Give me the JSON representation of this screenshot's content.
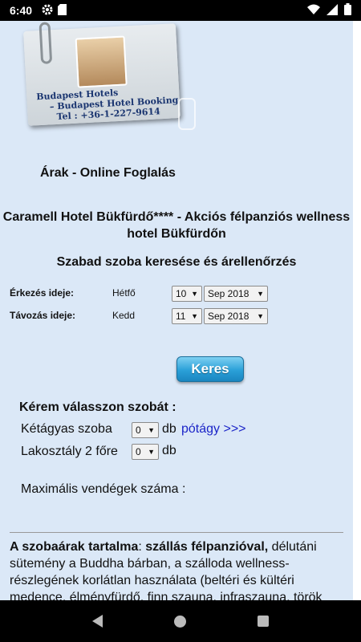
{
  "statusbar": {
    "time": "6:40",
    "icons": [
      "gear-icon",
      "sd-card-icon",
      "wifi-icon",
      "signal-icon",
      "battery-icon"
    ]
  },
  "logo_card": {
    "line1": "Budapest Hotels",
    "line2": "– Budapest Hotel Booking",
    "line3": "Tel : +36-1-227-9614"
  },
  "section_title": "Árak - Online Foglalás",
  "hotel_title": "Caramell Hotel Bükfürdő**** - Akciós félpanziós wellness hotel Bükfürdőn",
  "search_title": "Szabad szoba keresése és árellenőrzés",
  "arrival": {
    "label": "Érkezés ideje:",
    "day": "Hétfő",
    "date_value": "10",
    "month_value": "Sep 2018"
  },
  "departure": {
    "label": "Távozás ideje:",
    "day": "Kedd",
    "date_value": "11",
    "month_value": "Sep 2018"
  },
  "search_button": "Keres",
  "rooms": {
    "title": "Kérem válasszon szobát :",
    "items": [
      {
        "label": "Kétágyas szoba",
        "qty": "0",
        "unit": "db",
        "link": "pótágy >>>"
      },
      {
        "label": "Lakosztály 2 főre",
        "qty": "0",
        "unit": "db"
      }
    ],
    "max_guests": "Maximális vendégek száma :"
  },
  "description": {
    "lead_bold": "A szobaárak tartalma",
    "sep": ": ",
    "highlight_bold": "szállás félpanzióval,",
    "body": " délutáni sütemény a Buddha bárban, a szálloda wellness-részlegének korlátlan használata (beltéri és kültéri medence, élményfürdő, finn szauna, infraszauna, török gőzfürdő aromaterápiával, tepidárium, sóbarlang),"
  },
  "colors": {
    "page_bg": "#dbe8f7",
    "button": "#2aa0d8",
    "link": "#1c25c8"
  }
}
